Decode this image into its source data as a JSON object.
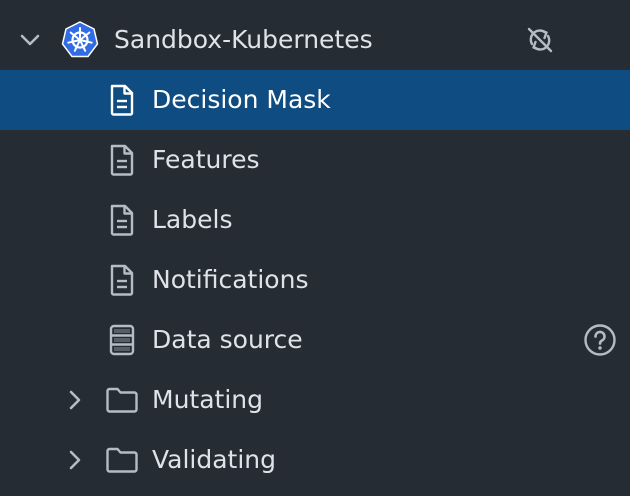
{
  "cluster": {
    "name": "Sandbox-Kubernetes",
    "icon": "kubernetes-icon",
    "action_icon": "sync-disabled-icon",
    "brand_color": "#326ce5"
  },
  "items": [
    {
      "label": "Decision Mask",
      "icon": "file-icon",
      "selected": true
    },
    {
      "label": "Features",
      "icon": "file-icon"
    },
    {
      "label": "Labels",
      "icon": "file-icon"
    },
    {
      "label": "Notifications",
      "icon": "file-icon"
    },
    {
      "label": "Data source",
      "icon": "database-icon",
      "trailing_icon": "help-icon"
    },
    {
      "label": "Mutating",
      "icon": "folder-icon",
      "expandable": true
    },
    {
      "label": "Validating",
      "icon": "folder-icon",
      "expandable": true
    }
  ],
  "colors": {
    "background": "#262c33",
    "selected": "#0f4c81",
    "text": "#dfe3e8",
    "icon": "#b5bcc5"
  }
}
